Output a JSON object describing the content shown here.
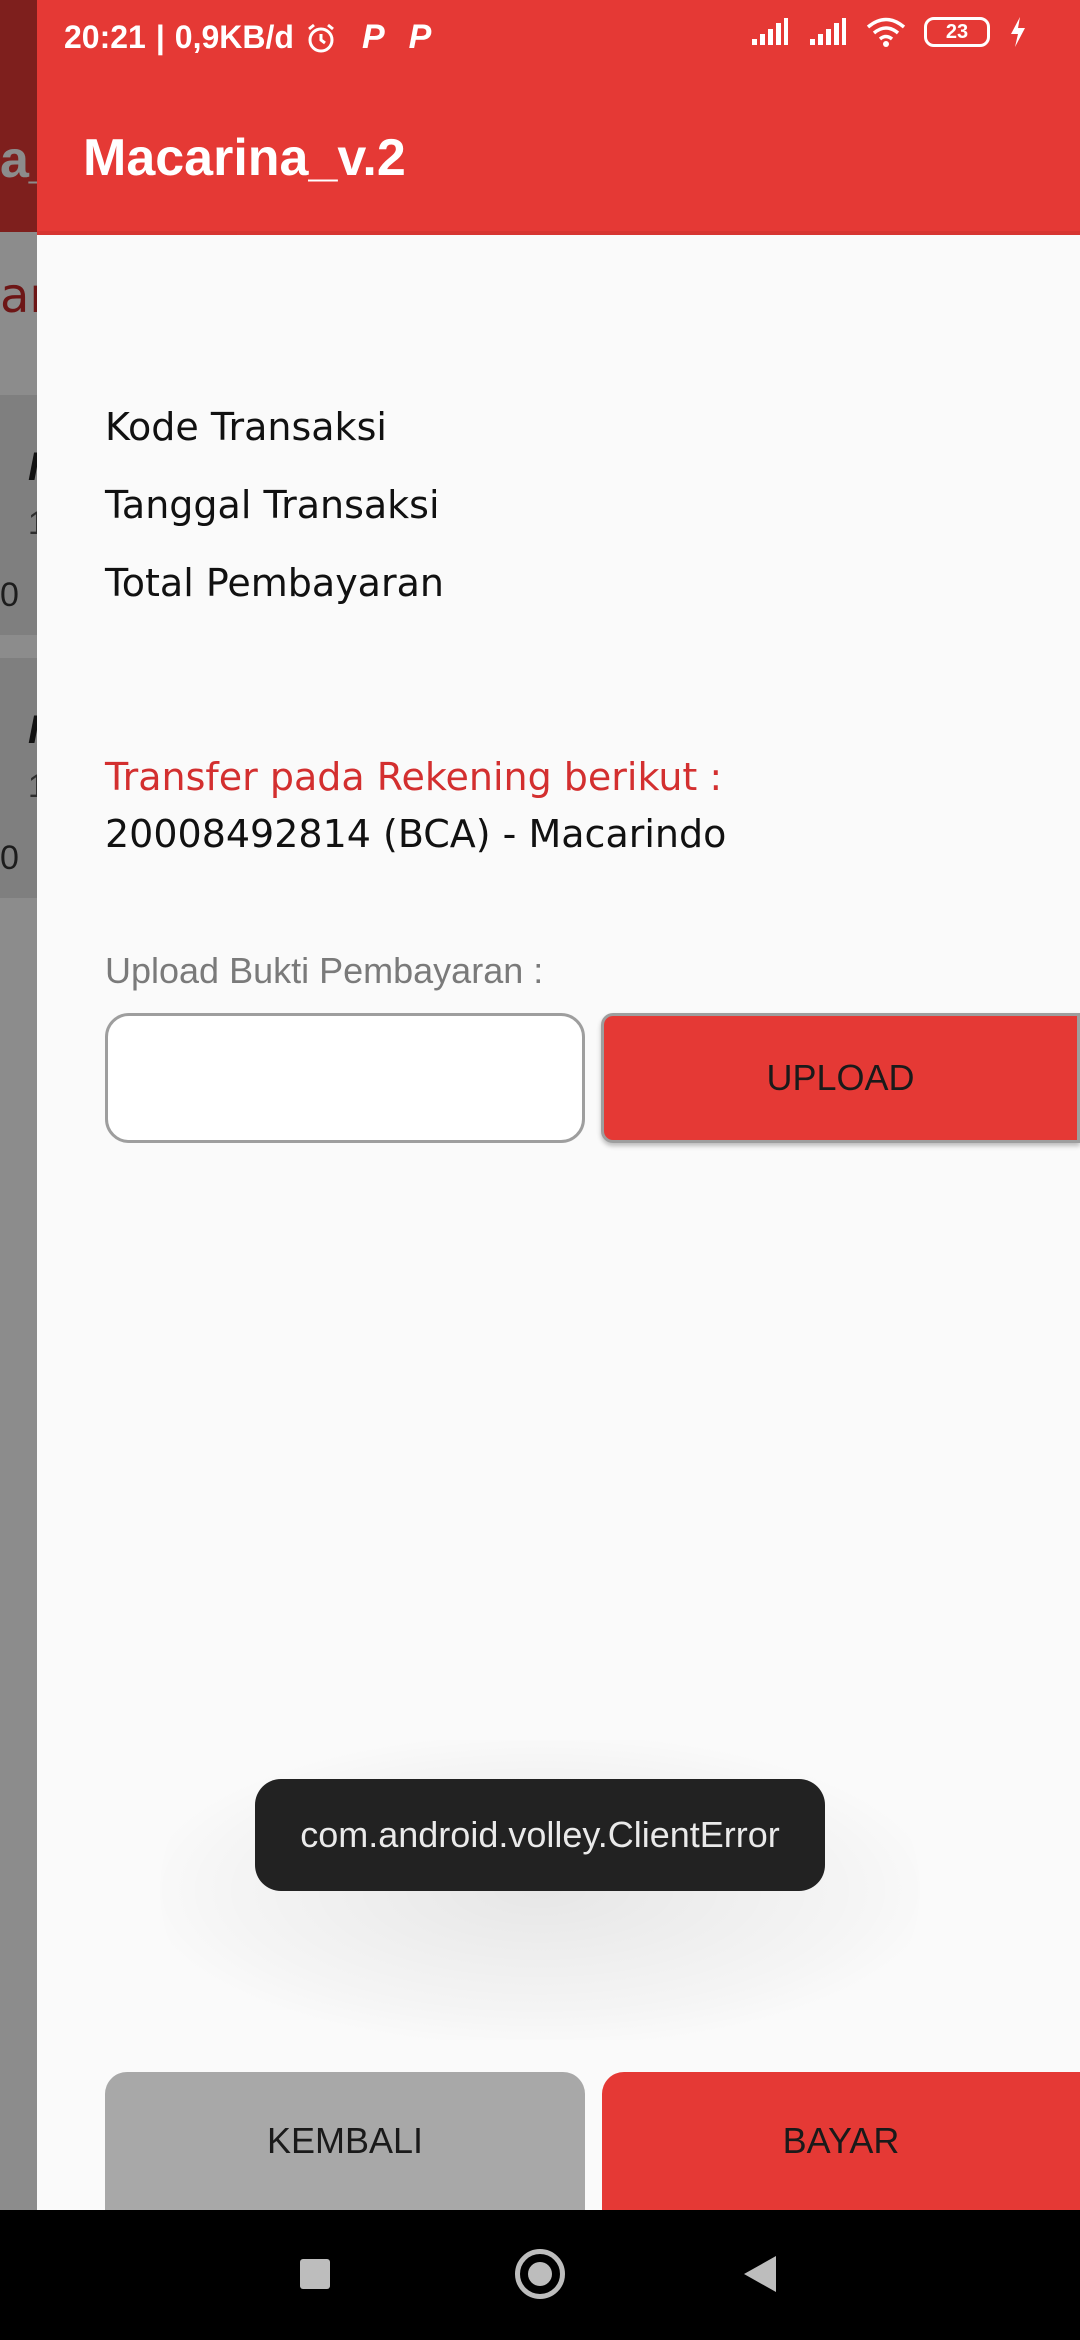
{
  "status_bar": {
    "time": "20:21",
    "network_speed": "0,9KB/d",
    "battery_level": "23",
    "icons": [
      "alarm-icon",
      "p-icon",
      "p-icon",
      "signal-icon",
      "signal-icon",
      "wifi-icon",
      "battery-icon",
      "charging-icon"
    ]
  },
  "background": {
    "app_title_fragment": "a_",
    "subtitle_fragment": "an",
    "card_letter": "I",
    "card_small": "1",
    "card_value": "0"
  },
  "dialog": {
    "title": "Macarina_v.2",
    "kode_label": "Kode Transaksi",
    "tanggal_label": "Tanggal Transaksi",
    "total_label": "Total Pembayaran",
    "transfer_label": "Transfer pada Rekening berikut :",
    "account_text": "20008492814 (BCA) - Macarindo",
    "upload_label": "Upload Bukti Pembayaran :",
    "upload_button": "UPLOAD",
    "toast_message": "com.android.volley.ClientError",
    "back_button": "KEMBALI",
    "pay_button": "BAYAR"
  },
  "colors": {
    "primary": "#e53935",
    "accent_text": "#d32f2f",
    "secondary_button": "#a8a8a8"
  }
}
